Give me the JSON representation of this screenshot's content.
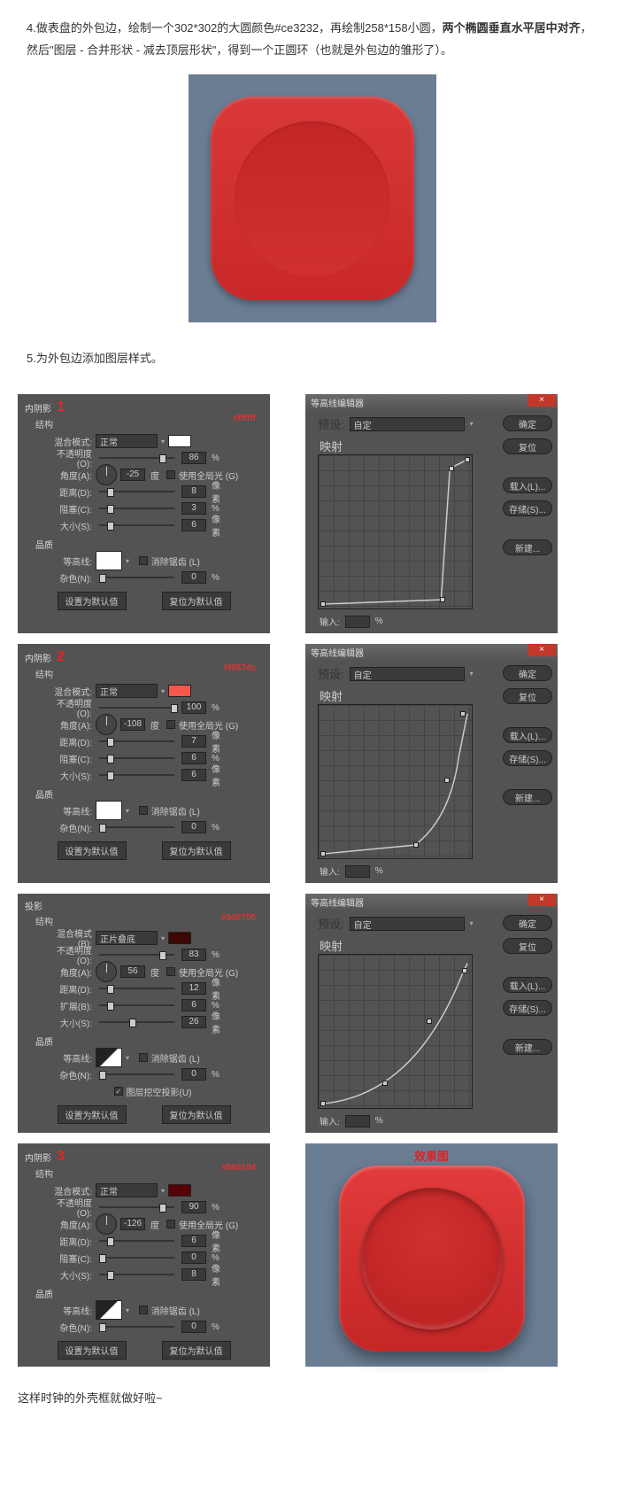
{
  "intro": {
    "line1_prefix": "4.做表盘的外包边，绘制一个302*302的大圆颜色#ce3232，再绘制258*158小圆，",
    "line2_bold": "两个椭圆垂直水平居中对齐",
    "line2_rest": "，然后\"图层 - 合并形状 - 减去顶层形状\"，得到一个正圆环（也就是外包边的雏形了）。"
  },
  "step5": "5.为外包边添加图层样式。",
  "labels": {
    "structure": "结构",
    "blend_mode": "混合模式:",
    "opacity": "不透明度(O):",
    "angle": "角度(A):",
    "deg": "度",
    "use_global": "使用全局光 (G)",
    "distance": "距离(D):",
    "choke": "阻塞(C):",
    "size": "大小(S):",
    "spread": "扩展(B):",
    "px": "像素",
    "pct": "%",
    "quality": "品质",
    "contour": "等高线:",
    "antialias": "消除锯齿 (L)",
    "noise": "杂色(N):",
    "knockout": "图层挖空投影(U)",
    "reset_default": "设置为默认值",
    "restore_default": "复位为默认值",
    "blend_mode_b": "混合模式(B):",
    "opacity_o": "不透明度(O):",
    "angle_a": "角度(A):"
  },
  "blend_modes": {
    "normal": "正常",
    "multiply": "正片叠底"
  },
  "panel1": {
    "title": "内阴影",
    "num": "1",
    "color_hex": "#ffffff",
    "opacity": "86",
    "angle": "-25",
    "distance": "8",
    "choke": "3",
    "size": "6",
    "noise": "0"
  },
  "panel2": {
    "title": "内阴影",
    "num": "2",
    "color_hex": "#f6574c",
    "opacity": "100",
    "angle": "-108",
    "distance": "7",
    "choke": "6",
    "size": "6",
    "noise": "0"
  },
  "panel3": {
    "title": "投影",
    "color_hex": "#3d0705",
    "opacity": "83",
    "angle": "56",
    "distance": "12",
    "spread": "6",
    "size": "26",
    "noise": "0"
  },
  "panel4": {
    "title": "内阴影",
    "num": "3",
    "color_hex": "#560104",
    "opacity": "90",
    "angle": "-126",
    "distance": "6",
    "choke": "0",
    "size": "8",
    "noise": "0"
  },
  "editor": {
    "title": "等高线编辑器",
    "preset": "预设:",
    "custom": "自定",
    "mapping": "映射",
    "input": "输入:",
    "pct": "%",
    "ok": "确定",
    "reset": "复位",
    "load": "载入(L)...",
    "save": "存储(S)...",
    "new": "新建..."
  },
  "result_title": "效果图",
  "outro": "这样时钟的外壳框就做好啦~"
}
